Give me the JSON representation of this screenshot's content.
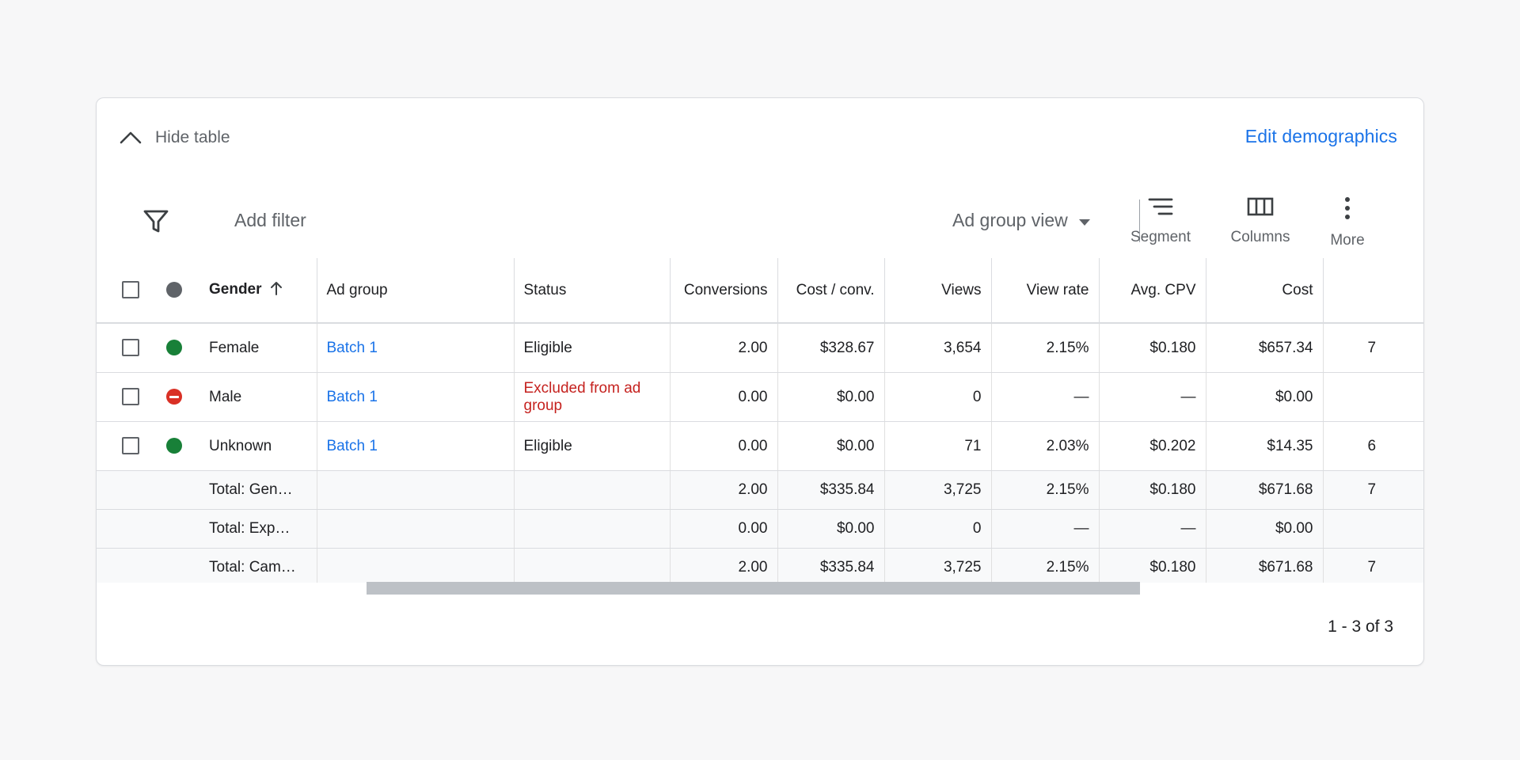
{
  "header": {
    "hide_table_label": "Hide table",
    "edit_demographics_label": "Edit demographics"
  },
  "toolbar": {
    "add_filter_label": "Add filter",
    "view_select_label": "Ad group view",
    "segment_label": "Segment",
    "columns_label": "Columns",
    "more_label": "More"
  },
  "table": {
    "columns": {
      "gender": "Gender",
      "ad_group": "Ad group",
      "status": "Status",
      "conversions": "Conversions",
      "cost_per_conv": "Cost / conv.",
      "views": "Views",
      "view_rate": "View rate",
      "avg_cpv": "Avg. CPV",
      "cost": "Cost"
    },
    "rows": [
      {
        "gender": "Female",
        "status_dot": "green",
        "ad_group": "Batch 1",
        "status": "Eligible",
        "conversions": "2.00",
        "cost_per_conv": "$328.67",
        "views": "3,654",
        "view_rate": "2.15%",
        "avg_cpv": "$0.180",
        "cost": "$657.34",
        "extra": "7"
      },
      {
        "gender": "Male",
        "status_dot": "red",
        "ad_group": "Batch 1",
        "status": "Excluded from ad group",
        "conversions": "0.00",
        "cost_per_conv": "$0.00",
        "views": "0",
        "view_rate": "—",
        "avg_cpv": "—",
        "cost": "$0.00",
        "extra": ""
      },
      {
        "gender": "Unknown",
        "status_dot": "green",
        "ad_group": "Batch 1",
        "status": "Eligible",
        "conversions": "0.00",
        "cost_per_conv": "$0.00",
        "views": "71",
        "view_rate": "2.03%",
        "avg_cpv": "$0.202",
        "cost": "$14.35",
        "extra": "6"
      }
    ],
    "totals": [
      {
        "label": "Total: Gen…",
        "conversions": "2.00",
        "cost_per_conv": "$335.84",
        "views": "3,725",
        "view_rate": "2.15%",
        "avg_cpv": "$0.180",
        "cost": "$671.68",
        "extra": "7"
      },
      {
        "label": "Total: Exp…",
        "conversions": "0.00",
        "cost_per_conv": "$0.00",
        "views": "0",
        "view_rate": "—",
        "avg_cpv": "—",
        "cost": "$0.00",
        "extra": ""
      },
      {
        "label": "Total: Cam…",
        "conversions": "2.00",
        "cost_per_conv": "$335.84",
        "views": "3,725",
        "view_rate": "2.15%",
        "avg_cpv": "$0.180",
        "cost": "$671.68",
        "extra": "7"
      }
    ]
  },
  "pagination": {
    "label": "1 - 3 of 3"
  },
  "colors": {
    "accent": "#1a73e8",
    "eligible": "#188038",
    "excluded": "#d93025",
    "excluded_text": "#c5221f"
  }
}
